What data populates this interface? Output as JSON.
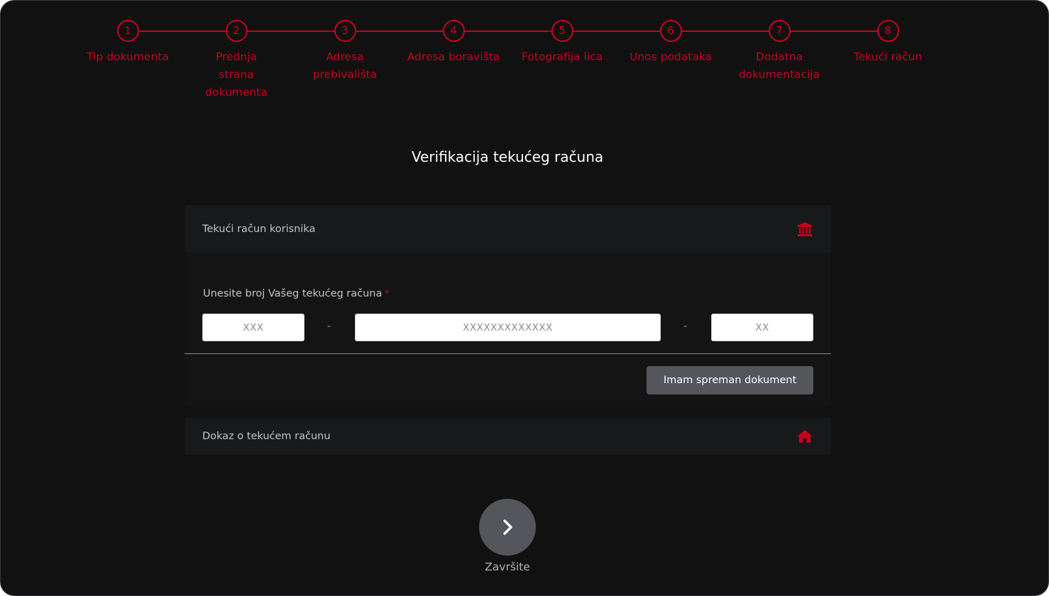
{
  "stepper": {
    "steps": [
      {
        "number": "1",
        "label": "Tip dokumenta"
      },
      {
        "number": "2",
        "label": "Prednja strana dokumenta"
      },
      {
        "number": "3",
        "label": "Adresa prebivališta"
      },
      {
        "number": "4",
        "label": "Adresa boravišta"
      },
      {
        "number": "5",
        "label": "Fotografija lica"
      },
      {
        "number": "6",
        "label": "Unos podataka"
      },
      {
        "number": "7",
        "label": "Dodatna dokumentacija"
      },
      {
        "number": "8",
        "label": "Tekući račun"
      }
    ]
  },
  "page": {
    "title": "Verifikacija tekućeg računa"
  },
  "account_panel": {
    "title": "Tekući račun korisnika",
    "icon": "bank-icon",
    "field_label": "Unesite broj Vašeg tekućeg računa",
    "required_mark": "*",
    "input_1": {
      "placeholder": "XXX",
      "value": ""
    },
    "separator_1": "-",
    "input_2": {
      "placeholder": "XXXXXXXXXXXXX",
      "value": ""
    },
    "separator_2": "-",
    "input_3": {
      "placeholder": "XX",
      "value": ""
    },
    "button_label": "Imam spreman dokument"
  },
  "proof_panel": {
    "title": "Dokaz o tekućem računu",
    "icon": "home-icon"
  },
  "footer": {
    "next_icon": "chevron-right-icon",
    "next_label": "Završite"
  },
  "colors": {
    "accent": "#c8001c",
    "background": "#111112",
    "panel": "#18191b",
    "button": "#55565c"
  }
}
